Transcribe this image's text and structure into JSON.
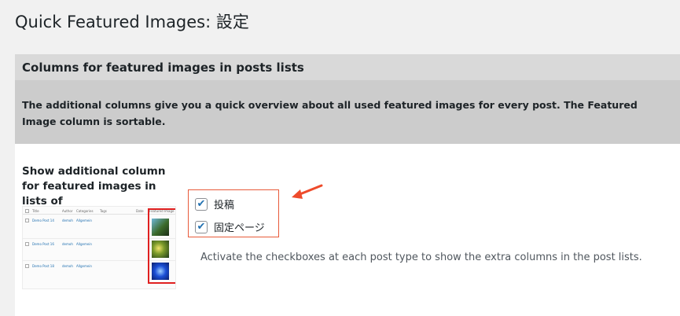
{
  "page": {
    "title": "Quick Featured Images: 設定"
  },
  "section": {
    "heading": "Columns for featured images in posts lists",
    "description": "The additional columns give you a quick overview about all used featured images for every post. The Featured Image column is sortable."
  },
  "setting": {
    "label": "Show additional column for featured images in lists of",
    "hint": "Activate the checkboxes at each post type to show the extra columns in the post lists.",
    "options": [
      {
        "label": "投稿",
        "checked": true
      },
      {
        "label": "固定ページ",
        "checked": true
      }
    ]
  },
  "preview": {
    "headers": [
      "Title",
      "Author",
      "Categories",
      "Tags",
      "Date",
      "Featured Image"
    ],
    "rows": [
      {
        "title": "Demo Post 14",
        "author": "demoh",
        "category": "Allgemein"
      },
      {
        "title": "Demo Post 16",
        "author": "demoh",
        "category": "Allgemein"
      },
      {
        "title": "Demo Post 18",
        "author": "demoh",
        "category": "Allgemein"
      }
    ]
  },
  "colors": {
    "accent": "#2271b1",
    "highlight": "#e02020",
    "arrow": "#ee4b2b"
  },
  "icons": {
    "check": "checkmark-icon",
    "arrow": "arrow-left-icon"
  }
}
